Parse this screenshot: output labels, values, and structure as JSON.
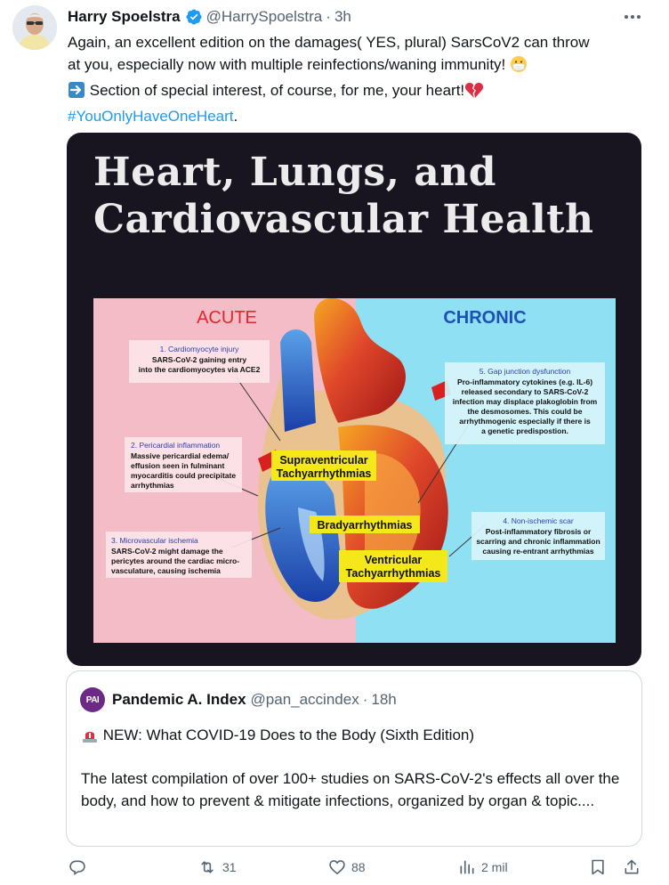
{
  "tweet": {
    "author_name": "Harry Spoelstra",
    "handle": "@HarrySpoelstra",
    "sep": "·",
    "time": "3h",
    "line1": "Again, an excellent edition on the damages( YES, plural) SarsCoV2 can throw",
    "line2": "at you, especially now with multiple reinfections/waning immunity!",
    "line3": "Section of special interest, of course, for me, your heart!",
    "hashtag": "#YouOnlyHaveOneHeart",
    "hashtag_end": "."
  },
  "media": {
    "title_line1": "Heart, Lungs, and",
    "title_line2": "Cardiovascular Health",
    "acute": "ACUTE",
    "chronic": "CHRONIC",
    "box1": {
      "title": "1. Cardiomyocyte injury",
      "lines": [
        "SARS-CoV-2 gaining entry",
        "into the cardiomyocytes via ACE2"
      ]
    },
    "box2": {
      "title": "2. Pericardial inflammation",
      "lines": [
        "Massive pericardial edema/",
        "effusion seen in fulminant",
        "myocarditis could precipitate",
        "arrhythmias"
      ]
    },
    "box3": {
      "title": "3. Microvascular ischemia",
      "lines": [
        "SARS-CoV-2 might damage the",
        "pericytes around the cardiac micro-",
        "vasculature, causing ischemia"
      ]
    },
    "box4": {
      "title": "4. Non-ischemic scar",
      "lines": [
        "Post-inflammatory fibrosis or",
        "scarring and chronic inflammation",
        "causing re-entrant arrhythmias"
      ]
    },
    "box5": {
      "title": "5. Gap junction dysfunction",
      "lines": [
        "Pro-inflammatory cytokines (e.g. IL-6)",
        "released secondary to SARS-CoV-2",
        "infection may displace plakoglobin from",
        "the desmosomes. This could be",
        "arrhythmogenic especially if there is",
        "a genetic predispostion."
      ]
    },
    "label_supra": [
      "Supraventricular",
      "Tachyarrhythmias"
    ],
    "label_brady": "Bradyarrhythmias",
    "label_vent": [
      "Ventricular",
      "Tachyarrhythmias"
    ]
  },
  "quote": {
    "avatar_text": "PAI",
    "author_name": "Pandemic A. Index",
    "handle": "@pan_accindex",
    "sep": "·",
    "time": "18h",
    "line1": "NEW: What COVID-19 Does to the Body (Sixth Edition)",
    "body": "The latest compilation of over 100+ studies on SARS-CoV-2's effects all over the body, and how to prevent & mitigate infections, organized by organ & topic...."
  },
  "actions": {
    "retweets": "31",
    "likes": "88",
    "views": "2 mil"
  },
  "colors": {
    "link": "#1d9bf0",
    "muted": "#536471",
    "acute": "#e0272a",
    "chronic": "#1d4fb8",
    "label_highlight": "#f4e81a"
  }
}
